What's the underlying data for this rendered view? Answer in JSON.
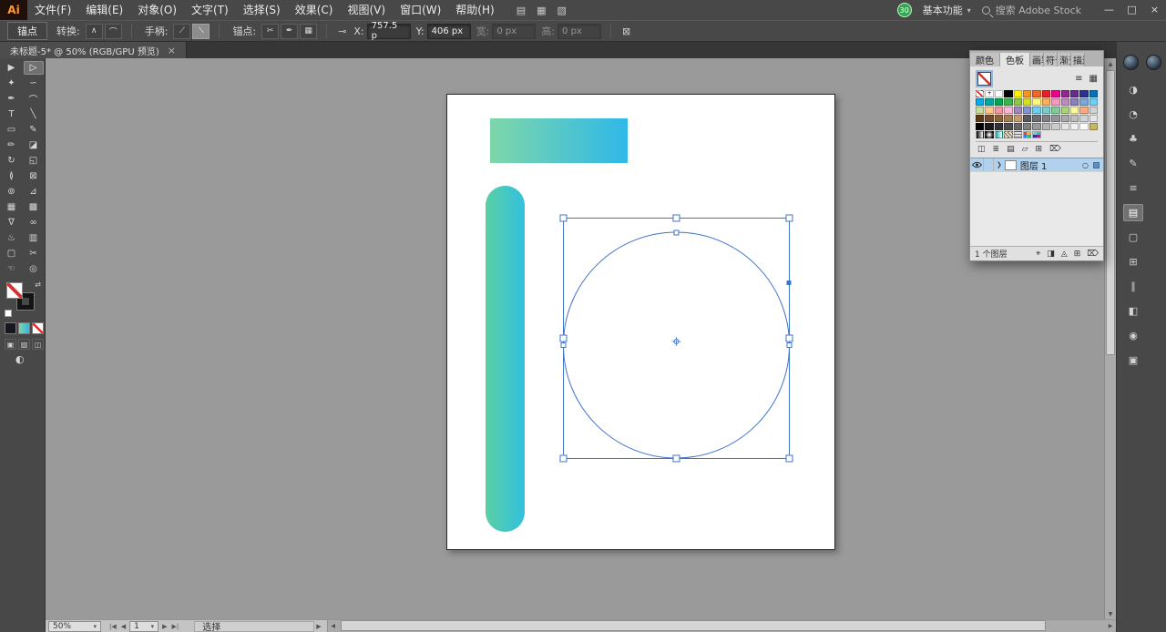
{
  "colors": {
    "gradient_start": "#7ed7a9",
    "gradient_end": "#2fb8e8",
    "capsule_start": "#5ad0a5",
    "capsule_end": "#32c0de",
    "selection": "#3f74c9"
  },
  "glyphs": {
    "caret": "▾",
    "up": "▲",
    "down": "▼",
    "left": "◀",
    "right": "▶",
    "swap": "⇄",
    "menu_arrow": "▶"
  },
  "menubar": {
    "logo_text": "Ai",
    "items": [
      "文件(F)",
      "编辑(E)",
      "对象(O)",
      "文字(T)",
      "选择(S)",
      "效果(C)",
      "视图(V)",
      "窗口(W)",
      "帮助(H)"
    ],
    "app_icons": [
      {
        "name": "arrange-documents-icon",
        "glyph": "▤"
      },
      {
        "name": "document-grid-icon",
        "glyph": "▦"
      },
      {
        "name": "screen-layout-icon",
        "glyph": "▧"
      }
    ],
    "trial_badge": "30",
    "workspace_switcher": "基本功能",
    "search_label": "搜索 Adobe Stock",
    "window_controls": {
      "minimize": "—",
      "maximize": "□",
      "close": "×"
    }
  },
  "controlbar": {
    "context_label": "锚点",
    "convert": {
      "label": "转换:",
      "buttons": [
        {
          "name": "convert-to-corner-icon",
          "glyph": "∧"
        },
        {
          "name": "convert-to-smooth-icon",
          "glyph": "⌒"
        }
      ]
    },
    "handles": {
      "label": "手柄:",
      "buttons": [
        {
          "name": "show-handles-icon",
          "glyph": "⟋"
        },
        {
          "name": "hide-handles-icon",
          "glyph": "⟍",
          "active": true
        }
      ]
    },
    "anchors": {
      "label": "锚点:",
      "buttons": [
        {
          "name": "remove-anchor-icon",
          "glyph": "✂"
        },
        {
          "name": "connect-anchors-icon",
          "glyph": "✒"
        },
        {
          "name": "isolate-object-icon",
          "glyph": "▦"
        }
      ]
    },
    "link_icon": {
      "glyph": "⊸"
    },
    "x": {
      "label": "X:",
      "value": "757.5 p"
    },
    "y": {
      "label": "Y:",
      "value": "406 px"
    },
    "w": {
      "label": "宽:",
      "value": "0 px"
    },
    "h": {
      "label": "高:",
      "value": "0 px"
    },
    "end_icon": {
      "glyph": "⊠"
    }
  },
  "tabbar": {
    "title": "未标题-5* @ 50% (RGB/GPU 预览)",
    "close": "×"
  },
  "toolbar": {
    "tools": [
      {
        "name": "selection-tool",
        "glyph": "▶"
      },
      {
        "name": "direct-selection-tool",
        "glyph": "▷",
        "active": true
      },
      {
        "name": "magic-wand-tool",
        "glyph": "✦"
      },
      {
        "name": "lasso-tool",
        "glyph": "∽"
      },
      {
        "name": "pen-tool",
        "glyph": "✒"
      },
      {
        "name": "curvature-tool",
        "glyph": "⌒"
      },
      {
        "name": "type-tool",
        "glyph": "T"
      },
      {
        "name": "line-segment-tool",
        "glyph": "╲"
      },
      {
        "name": "rectangle-tool",
        "glyph": "▭"
      },
      {
        "name": "paintbrush-tool",
        "glyph": "✎"
      },
      {
        "name": "pencil-tool",
        "glyph": "✏"
      },
      {
        "name": "eraser-tool",
        "glyph": "◪"
      },
      {
        "name": "rotate-tool",
        "glyph": "↻"
      },
      {
        "name": "scale-tool",
        "glyph": "◱"
      },
      {
        "name": "width-tool",
        "glyph": "≬"
      },
      {
        "name": "free-transform-tool",
        "glyph": "⊠"
      },
      {
        "name": "shape-builder-tool",
        "glyph": "⊚"
      },
      {
        "name": "perspective-grid-tool",
        "glyph": "⊿"
      },
      {
        "name": "mesh-tool",
        "glyph": "▦"
      },
      {
        "name": "gradient-tool",
        "glyph": "▩"
      },
      {
        "name": "eyedropper-tool",
        "glyph": "∇"
      },
      {
        "name": "blend-tool",
        "glyph": "∞"
      },
      {
        "name": "symbol-sprayer-tool",
        "glyph": "♨"
      },
      {
        "name": "column-graph-tool",
        "glyph": "▥"
      },
      {
        "name": "artboard-tool",
        "glyph": "▢"
      },
      {
        "name": "slice-tool",
        "glyph": "✂"
      },
      {
        "name": "hand-tool",
        "glyph": "☜"
      },
      {
        "name": "zoom-tool",
        "glyph": "◎"
      }
    ],
    "draw_modes": [
      {
        "name": "draw-normal-icon",
        "glyph": "▣"
      },
      {
        "name": "draw-behind-icon",
        "glyph": "▨"
      },
      {
        "name": "draw-inside-icon",
        "glyph": "◫"
      }
    ],
    "screen_mode_glyph": "◐"
  },
  "panels": {
    "tabs": [
      {
        "name": "tab-color",
        "label": "颜色"
      },
      {
        "name": "tab-swatches",
        "label": "色板",
        "active": true
      },
      {
        "name": "tab-brushes",
        "label": "画笔",
        "narrow": true
      },
      {
        "name": "tab-symbols",
        "label": "符号",
        "narrow": true
      },
      {
        "name": "tab-gradient",
        "label": "渐变",
        "narrow": true
      },
      {
        "name": "tab-stroke",
        "label": "描边",
        "narrow": true
      }
    ],
    "overflow_glyph": "»",
    "menu_glyph": "≡",
    "grid_glyph": "▦",
    "swatches": {
      "grid": [
        [
          "none",
          "reg",
          "#ffffff",
          "#000000",
          "#fff200",
          "#f7941d",
          "#f26522",
          "#ed1c24",
          "#ec008c",
          "#92278f",
          "#662d91",
          "#2e3192",
          "#0072bc"
        ],
        [
          "#00aeef",
          "#00a99d",
          "#00a651",
          "#39b54a",
          "#8dc63f",
          "#d7df23",
          "#fff680",
          "#fbaf5d",
          "#f49ac1",
          "#bd8cbf",
          "#8781bd",
          "#7da7d9",
          "#6dcff6"
        ],
        [
          "#c4df9b",
          "#fdc68c",
          "#f5989d",
          "#f7b6d1",
          "#a186be",
          "#8493ca",
          "#6ecff6",
          "#7bcdc9",
          "#82ca9c",
          "#acd373",
          "#fff799",
          "#f9ad81",
          "#d0d2d3"
        ],
        [
          "#603913",
          "#754c29",
          "#8c6239",
          "#a97c50",
          "#c69c6d",
          "#59595b",
          "#6d6e70",
          "#808184",
          "#929497",
          "#a7a9ab",
          "#bbbdbf",
          "#d0d2d3",
          "#e6e7e8"
        ],
        [
          "#000000",
          "#1a1a1a",
          "#333333",
          "#4d4d4d",
          "#666666",
          "#808080",
          "#999999",
          "#b3b3b3",
          "#cccccc",
          "#e6e6e6",
          "#f2f2f2",
          "#ffffff",
          "#c8b568"
        ],
        [
          "grad-linear",
          "grad-radial",
          "grad-fade",
          "pat-lines",
          "pat-grid",
          "group-a",
          "group-b",
          "empty",
          "empty",
          "empty",
          "empty",
          "empty",
          "empty"
        ]
      ],
      "footer_icons": [
        {
          "name": "libraries-icon",
          "glyph": "◫"
        },
        {
          "name": "swatch-kinds-icon",
          "glyph": "≣"
        },
        {
          "name": "swatch-options-icon",
          "glyph": "▤"
        },
        {
          "name": "new-color-group-icon",
          "glyph": "▱"
        },
        {
          "name": "new-swatch-icon",
          "glyph": "⊞"
        },
        {
          "name": "delete-swatch-icon",
          "glyph": "⌦"
        }
      ]
    },
    "layers": {
      "rows": [
        {
          "label": "图层 1",
          "selected": true
        }
      ],
      "disclosure_glyph": "❯",
      "target_glyph": "○",
      "footer_label": "1 个图层",
      "footer_icons": [
        {
          "name": "locate-object-icon",
          "glyph": "⌖"
        },
        {
          "name": "make-clipping-mask-icon",
          "glyph": "◨"
        },
        {
          "name": "new-sublayer-icon",
          "glyph": "◬"
        },
        {
          "name": "new-layer-icon",
          "glyph": "⊞"
        },
        {
          "name": "delete-layer-icon",
          "glyph": "⌦"
        }
      ]
    }
  },
  "dock": {
    "top_icons": [
      {
        "name": "color-themes-icon"
      },
      {
        "name": "cc-libraries-icon"
      }
    ],
    "icons": [
      {
        "name": "color-panel-icon",
        "glyph": "◑"
      },
      {
        "name": "color-guide-icon",
        "glyph": "◔"
      },
      {
        "name": "symbols-panel-icon",
        "glyph": "♣"
      },
      {
        "name": "brushes-panel-icon",
        "glyph": "✎"
      },
      {
        "name": "stroke-panel-icon",
        "glyph": "≡"
      },
      {
        "name": "layers-panel-icon",
        "glyph": "▤",
        "active": true
      },
      {
        "name": "artboards-panel-icon",
        "glyph": "▢"
      },
      {
        "name": "transform-panel-icon",
        "glyph": "⊞"
      },
      {
        "name": "align-panel-icon",
        "glyph": "∥"
      },
      {
        "name": "pathfinder-panel-icon",
        "glyph": "◧"
      },
      {
        "name": "appearance-panel-icon",
        "glyph": "◉"
      },
      {
        "name": "graphic-styles-panel-icon",
        "glyph": "▣"
      }
    ]
  },
  "statusbar": {
    "zoom": "50%",
    "nav": {
      "first": "|◀",
      "prev": "◀",
      "artboard": "1",
      "next": "▶",
      "last": "▶|"
    },
    "status_label": "选择"
  }
}
